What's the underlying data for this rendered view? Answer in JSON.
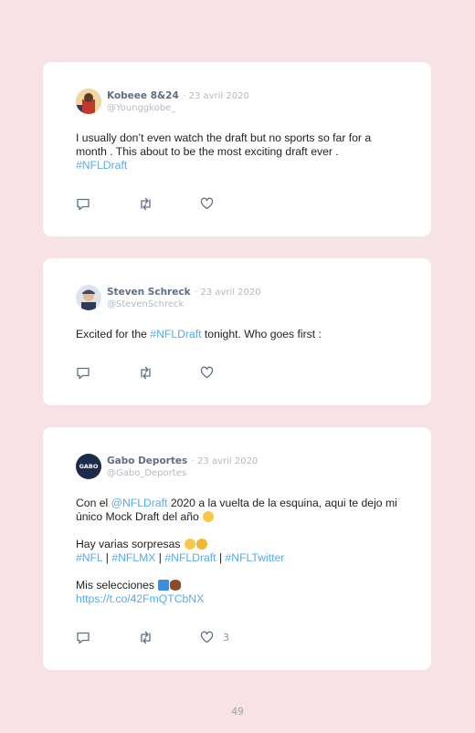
{
  "tweets": [
    {
      "author": "Kobeee 8&24",
      "date": "· 23 avril 2020",
      "handle": "@Younggkobe_",
      "text": "I usually don’t even watch the draft but no sports so far for a month . This about to be the most exciting draft ever .",
      "hashtag": "#NFLDraft"
    },
    {
      "author": "Steven Schreck",
      "date": "· 23 avril 2020",
      "handle": "@StevenSchreck",
      "text_before": "Excited for the ",
      "hashtag": "#NFLDraft",
      "text_after": " tonight. Who goes first :"
    },
    {
      "author": "Gabo Deportes",
      "date": "· 23 avril 2020",
      "handle": "@Gabo_Deportes",
      "avatar_text": "GABO",
      "line1_before": "Con el ",
      "mention": "@NFLDraft",
      "line1_after": " 2020 a la vuelta de la esquina, aqui te dejo mi único Mock Draft del año",
      "line2": "Hay varias sorpresas",
      "hashtags": [
        "#NFL",
        "#NFLMX",
        "#NFLDraft",
        "#NFLTwitter"
      ],
      "tag_separator": "|",
      "line3": "Mis selecciones",
      "url": "https://t.co/42FmQTCbNX",
      "like_count": "3"
    }
  ],
  "icons": [
    "reply-icon",
    "retweet-icon",
    "like-icon"
  ],
  "colors": {
    "background": "#f7e3e5",
    "card": "#ffffff",
    "link": "#55acee",
    "muted": "#b3b9c2",
    "name": "#5f6f83"
  },
  "page_number": "49"
}
